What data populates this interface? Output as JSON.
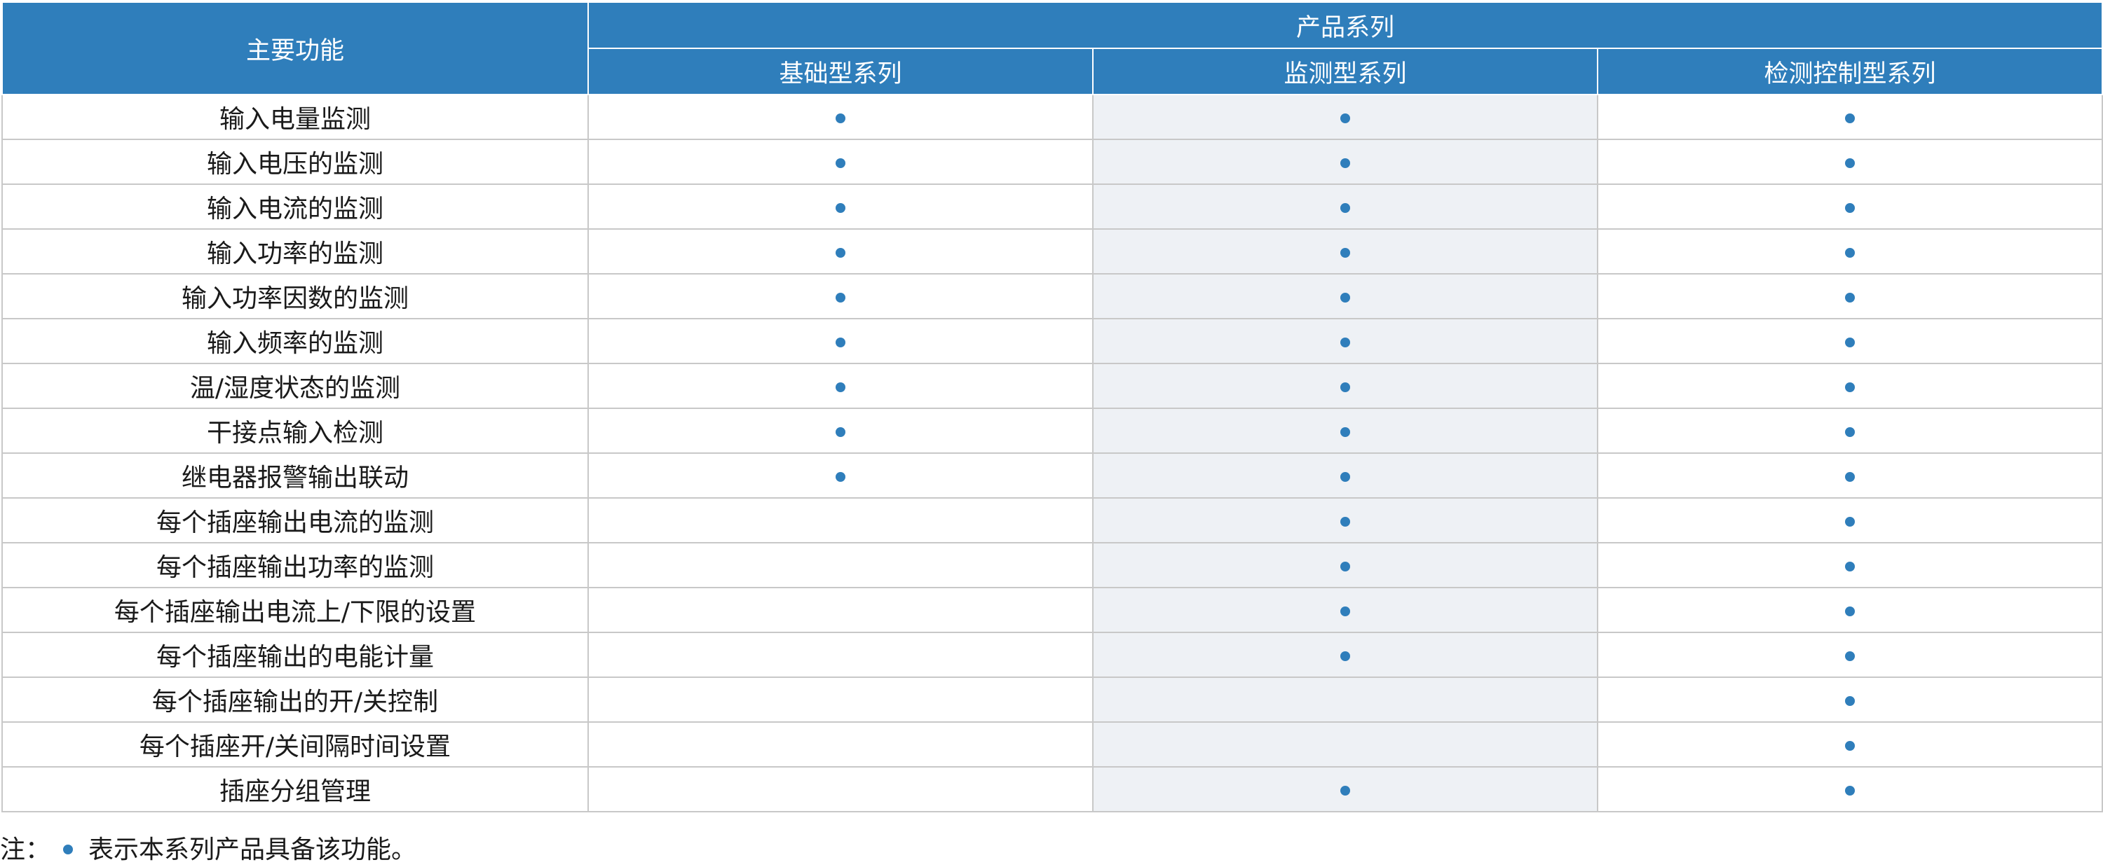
{
  "table": {
    "header_function": "主要功能",
    "header_group": "产品系列",
    "series": [
      "基础型系列",
      "监测型系列",
      "检测控制型系列"
    ],
    "mark_icon": "filled-dot",
    "mark_color": "#2f7ebb",
    "header_color": "#2f7ebb",
    "rows": [
      {
        "feature": "输入电量监测",
        "marks": [
          true,
          true,
          true
        ]
      },
      {
        "feature": "输入电压的监测",
        "marks": [
          true,
          true,
          true
        ]
      },
      {
        "feature": "输入电流的监测",
        "marks": [
          true,
          true,
          true
        ]
      },
      {
        "feature": "输入功率的监测",
        "marks": [
          true,
          true,
          true
        ]
      },
      {
        "feature": "输入功率因数的监测",
        "marks": [
          true,
          true,
          true
        ]
      },
      {
        "feature": "输入频率的监测",
        "marks": [
          true,
          true,
          true
        ]
      },
      {
        "feature": "温/湿度状态的监测",
        "marks": [
          true,
          true,
          true
        ]
      },
      {
        "feature": "干接点输入检测",
        "marks": [
          true,
          true,
          true
        ]
      },
      {
        "feature": "继电器报警输出联动",
        "marks": [
          true,
          true,
          true
        ]
      },
      {
        "feature": "每个插座输出电流的监测",
        "marks": [
          false,
          true,
          true
        ]
      },
      {
        "feature": "每个插座输出功率的监测",
        "marks": [
          false,
          true,
          true
        ]
      },
      {
        "feature": "每个插座输出电流上/下限的设置",
        "marks": [
          false,
          true,
          true
        ]
      },
      {
        "feature": "每个插座输出的电能计量",
        "marks": [
          false,
          true,
          true
        ]
      },
      {
        "feature": "每个插座输出的开/关控制",
        "marks": [
          false,
          false,
          true
        ]
      },
      {
        "feature": "每个插座开/关间隔时间设置",
        "marks": [
          false,
          false,
          true
        ]
      },
      {
        "feature": "插座分组管理",
        "marks": [
          false,
          true,
          true
        ]
      }
    ]
  },
  "note": {
    "prefix": "注：",
    "text": "表示本系列产品具备该功能。"
  }
}
